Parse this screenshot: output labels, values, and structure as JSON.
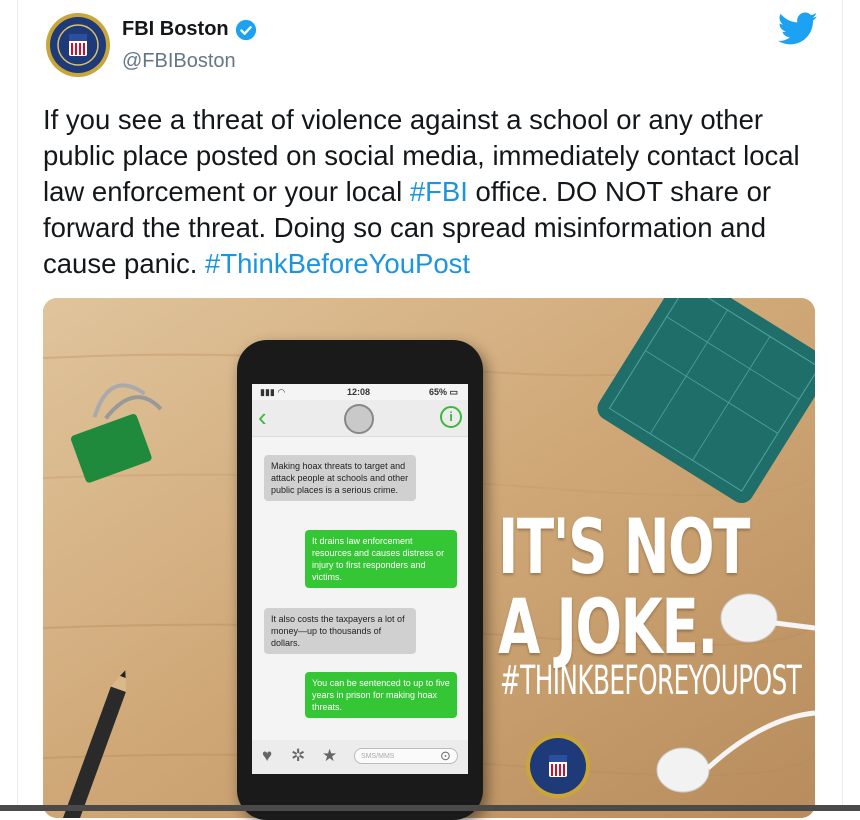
{
  "account": {
    "name": "FBI Boston",
    "handle": "@FBIBoston"
  },
  "tweet": {
    "part1": "If you see a threat of violence against a school or any other public place posted on social media, immediately contact local law enforcement or your local ",
    "hashtag1": "#FBI",
    "part2": " office. DO NOT share or forward the threat. Doing so can spread misinformation and cause panic. ",
    "hashtag2": "#ThinkBeforeYouPost"
  },
  "image": {
    "headline_line1": "IT'S NOT",
    "headline_line2": "A JOKE.",
    "hashtag": "#THINKBEFOREYOUPOST",
    "phone": {
      "time": "12:08",
      "battery": "65%",
      "messages": [
        "Making hoax threats to target and attack people at schools and other public places is a serious crime.",
        "It drains law enforcement resources and causes distress or injury to first responders and victims.",
        "It also costs the taxpayers a lot of money—up to thousands of dollars.",
        "You can be sentenced to up to five years in prison for making hoax threats."
      ],
      "compose_placeholder": "SMS/MMS"
    }
  },
  "colors": {
    "link": "#1b95e0",
    "twitter_blue": "#1da1f2",
    "sms_green": "#34c634"
  },
  "icons": [
    "fbi-seal-icon",
    "verified-badge-icon",
    "twitter-bird-icon",
    "back-chevron-icon",
    "info-icon",
    "heart-icon",
    "gear-icon",
    "star-icon",
    "send-icon"
  ]
}
